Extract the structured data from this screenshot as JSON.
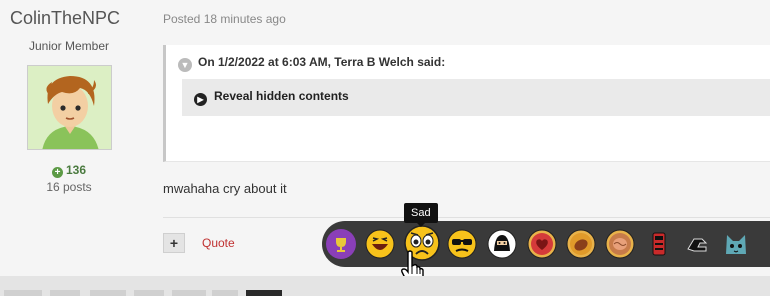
{
  "author": {
    "username": "ColinTheNPC",
    "rank": "Junior Member",
    "reputation": "136",
    "post_count": "16 posts"
  },
  "post": {
    "posted": "Posted 18 minutes ago",
    "quote": {
      "header": "On 1/2/2022 at 6:03 AM, Terra B Welch said:",
      "spoiler_label": "Reveal hidden contents"
    },
    "body": "mwahaha cry about it",
    "actions": {
      "add_icon": "+",
      "quote_label": "Quote"
    }
  },
  "reactions": {
    "tooltip": "Sad",
    "items": [
      {
        "name": "trophy-reaction",
        "color": "#8a3fb8"
      },
      {
        "name": "laugh-reaction",
        "color": "#f7c21b"
      },
      {
        "name": "sad-reaction",
        "color": "#f7c21b"
      },
      {
        "name": "sunglasses-reaction",
        "color": "#f7c21b"
      },
      {
        "name": "ninja-reaction",
        "color": "#ffffff"
      },
      {
        "name": "heart-reaction",
        "color": "#d43a3a"
      },
      {
        "name": "fruit-reaction",
        "color": "#e09a2a"
      },
      {
        "name": "brain-reaction",
        "color": "#c77b4a"
      },
      {
        "name": "door-reaction",
        "color": "#c92a2a"
      },
      {
        "name": "arm-reaction",
        "color": "#2b2b2b"
      },
      {
        "name": "cat-reaction",
        "color": "#5fa8b5"
      }
    ]
  }
}
